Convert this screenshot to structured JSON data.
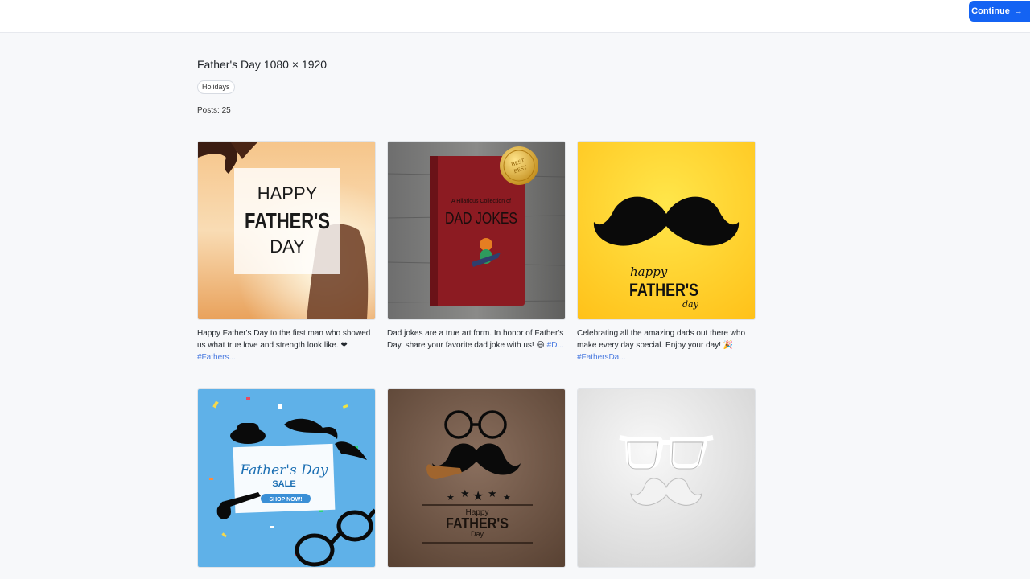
{
  "header": {
    "continue_label": "Continue",
    "continue_icon": "arrow-right-icon"
  },
  "collection": {
    "title": "Father's Day 1080 × 1920",
    "tag": "Holidays",
    "posts_label": "Posts: 25"
  },
  "posts": [
    {
      "image_text": [
        "HAPPY",
        "FATHER'S",
        "DAY"
      ],
      "caption": "Happy Father's Day to the first man who showed us what true love and strength look like. ❤ ",
      "hashtag": "#Fathers..."
    },
    {
      "image_text": [
        "A Hilarious Collection of",
        "DAD JOKES",
        "BEST",
        "BEST"
      ],
      "caption": "Dad jokes are a true art form. In honor of Father's Day, share your favorite dad joke with us! 😄 ",
      "hashtag": "#D..."
    },
    {
      "image_text": [
        "happy",
        "FATHER'S",
        "day"
      ],
      "caption": "Celebrating all the amazing dads out there who make every day special. Enjoy your day! 🎉 ",
      "hashtag": "#FathersDa..."
    },
    {
      "image_text": [
        "Father's Day",
        "SALE",
        "SHOP NOW!"
      ]
    },
    {
      "image_text": [
        "Happy",
        "FATHER'S",
        "Day"
      ]
    },
    {
      "image_text": []
    }
  ],
  "colors": {
    "accent": "#1463f3",
    "hashtag": "#4b7be0"
  }
}
